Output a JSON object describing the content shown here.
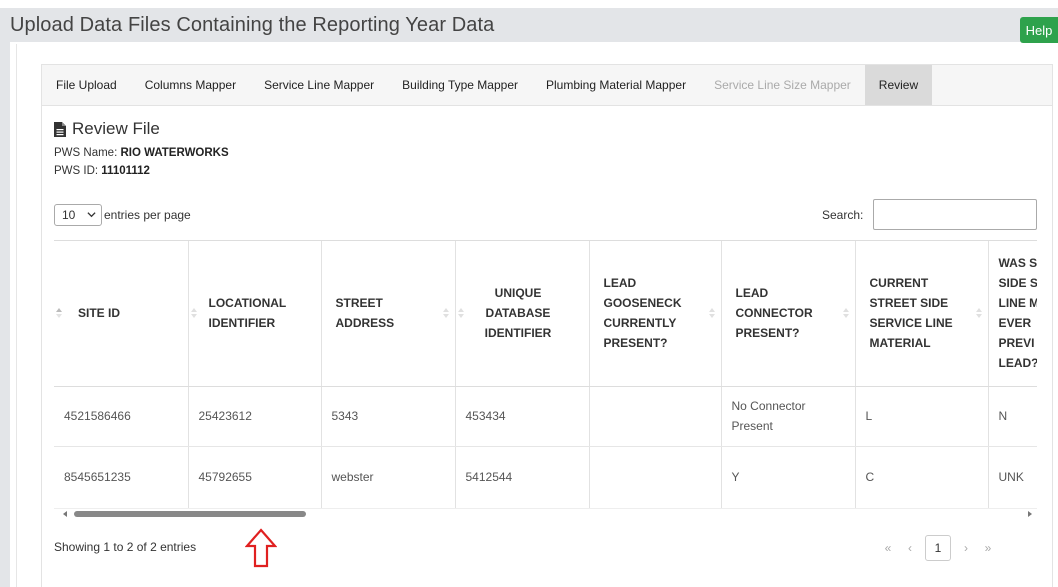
{
  "header": {
    "title": "Upload Data Files Containing the Reporting Year Data",
    "help_label": "Help",
    "help_color": "#2ea24c"
  },
  "tabs": [
    {
      "label": "File Upload",
      "state": "normal"
    },
    {
      "label": "Columns Mapper",
      "state": "normal"
    },
    {
      "label": "Service Line Mapper",
      "state": "normal"
    },
    {
      "label": "Building Type Mapper",
      "state": "normal"
    },
    {
      "label": "Plumbing Material Mapper",
      "state": "normal"
    },
    {
      "label": "Service Line Size Mapper",
      "state": "disabled"
    },
    {
      "label": "Review",
      "state": "active"
    }
  ],
  "review": {
    "title": "Review File",
    "icon": "file-icon",
    "pws_name_label": "PWS Name:",
    "pws_name_value": "RIO WATERWORKS",
    "pws_id_label": "PWS ID:",
    "pws_id_value": "11101112"
  },
  "table_controls": {
    "length_value": "10",
    "length_suffix": "entries per page",
    "search_label": "Search:",
    "search_value": ""
  },
  "table": {
    "columns": [
      [
        "SITE ID"
      ],
      [
        "LOCATIONAL",
        "IDENTIFIER"
      ],
      [
        "STREET",
        "ADDRESS"
      ],
      [
        "UNIQUE",
        "DATABASE",
        "IDENTIFIER"
      ],
      [
        "LEAD",
        "GOOSENECK",
        "CURRENTLY",
        "PRESENT?"
      ],
      [
        "LEAD",
        "CONNECTOR",
        "PRESENT?"
      ],
      [
        "CURRENT",
        "STREET SIDE",
        "SERVICE LINE",
        "MATERIAL"
      ],
      [
        "WAS S",
        "SIDE S",
        "LINE M",
        "EVER",
        "PREVI",
        "LEAD?"
      ]
    ],
    "rows": [
      {
        "site_id": "4521586466",
        "locational": "25423612",
        "street": "5343",
        "unique_db": "453434",
        "gooseneck": "",
        "connector": [
          "No Connector",
          "Present"
        ],
        "material": "L",
        "prev_lead": "N"
      },
      {
        "site_id": "8545651235",
        "locational": "45792655",
        "street": "webster",
        "unique_db": "5412544",
        "gooseneck": "",
        "connector": [
          "Y"
        ],
        "material": "C",
        "prev_lead": "UNK"
      }
    ]
  },
  "scroll": {
    "horizontal_thumb_fraction": 0.24
  },
  "footer": {
    "info": "Showing 1 to 2 of 2 entries",
    "pager": {
      "first": "«",
      "prev": "‹",
      "current": "1",
      "next": "›",
      "last": "»"
    }
  },
  "annotation": {
    "arrow_color": "#e02020",
    "arrow_icon": "up-arrow-icon"
  }
}
